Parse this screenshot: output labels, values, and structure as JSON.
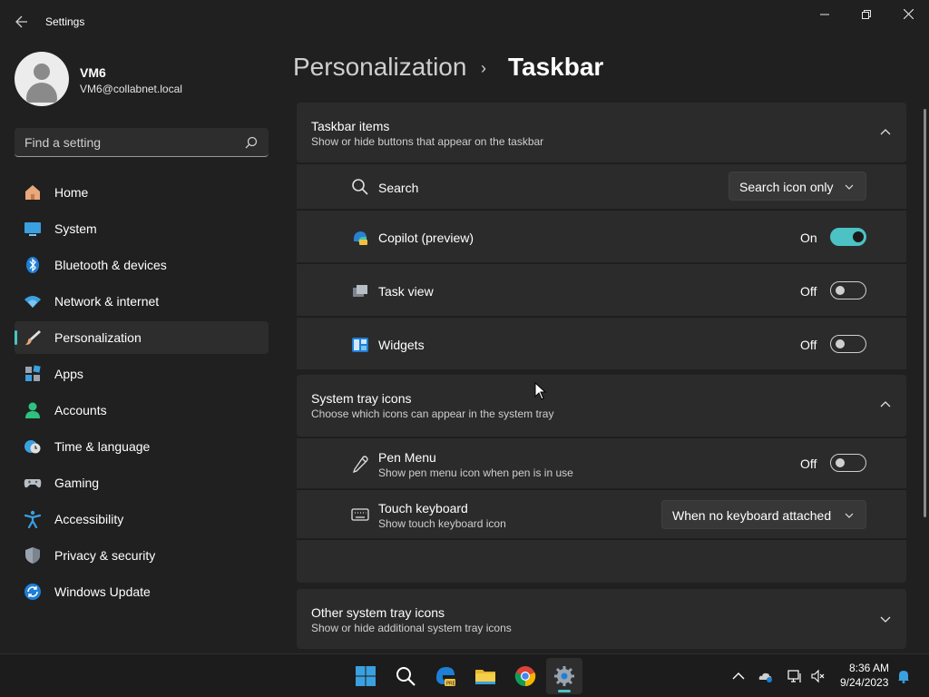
{
  "window": {
    "app_title": "Settings"
  },
  "profile": {
    "name": "VM6",
    "email": "VM6@collabnet.local"
  },
  "search": {
    "placeholder": "Find a setting"
  },
  "sidebar": {
    "items": [
      {
        "label": "Home",
        "icon": "home-icon"
      },
      {
        "label": "System",
        "icon": "system-icon"
      },
      {
        "label": "Bluetooth & devices",
        "icon": "bluetooth-icon"
      },
      {
        "label": "Network & internet",
        "icon": "wifi-icon"
      },
      {
        "label": "Personalization",
        "icon": "brush-icon",
        "selected": true
      },
      {
        "label": "Apps",
        "icon": "apps-icon"
      },
      {
        "label": "Accounts",
        "icon": "accounts-icon"
      },
      {
        "label": "Time & language",
        "icon": "clock-globe-icon"
      },
      {
        "label": "Gaming",
        "icon": "gamepad-icon"
      },
      {
        "label": "Accessibility",
        "icon": "accessibility-icon"
      },
      {
        "label": "Privacy & security",
        "icon": "shield-icon"
      },
      {
        "label": "Windows Update",
        "icon": "update-icon"
      }
    ]
  },
  "breadcrumb": {
    "parent": "Personalization",
    "separator": "›",
    "current": "Taskbar"
  },
  "taskbar_items": {
    "title": "Taskbar items",
    "subtitle": "Show or hide buttons that appear on the taskbar",
    "rows": {
      "search": {
        "label": "Search",
        "value": "Search icon only"
      },
      "copilot": {
        "label": "Copilot (preview)",
        "state": "On"
      },
      "task_view": {
        "label": "Task view",
        "state": "Off"
      },
      "widgets": {
        "label": "Widgets",
        "state": "Off"
      }
    }
  },
  "system_tray": {
    "title": "System tray icons",
    "subtitle": "Choose which icons can appear in the system tray",
    "rows": {
      "pen_menu": {
        "label": "Pen Menu",
        "sub": "Show pen menu icon when pen is in use",
        "state": "Off"
      },
      "touch_keyboard": {
        "label": "Touch keyboard",
        "sub": "Show touch keyboard icon",
        "value": "When no keyboard attached"
      }
    }
  },
  "other_tray": {
    "title": "Other system tray icons",
    "subtitle": "Show or hide additional system tray icons"
  },
  "taskbar": {
    "time": "8:36 AM",
    "date": "9/24/2023",
    "pinned": [
      "start-icon",
      "search-icon",
      "edge-dev-icon",
      "file-explorer-icon",
      "chrome-icon",
      "settings-icon"
    ]
  },
  "colors": {
    "accent": "#4cc2c4",
    "background": "#202020",
    "card": "#2b2b2b"
  }
}
